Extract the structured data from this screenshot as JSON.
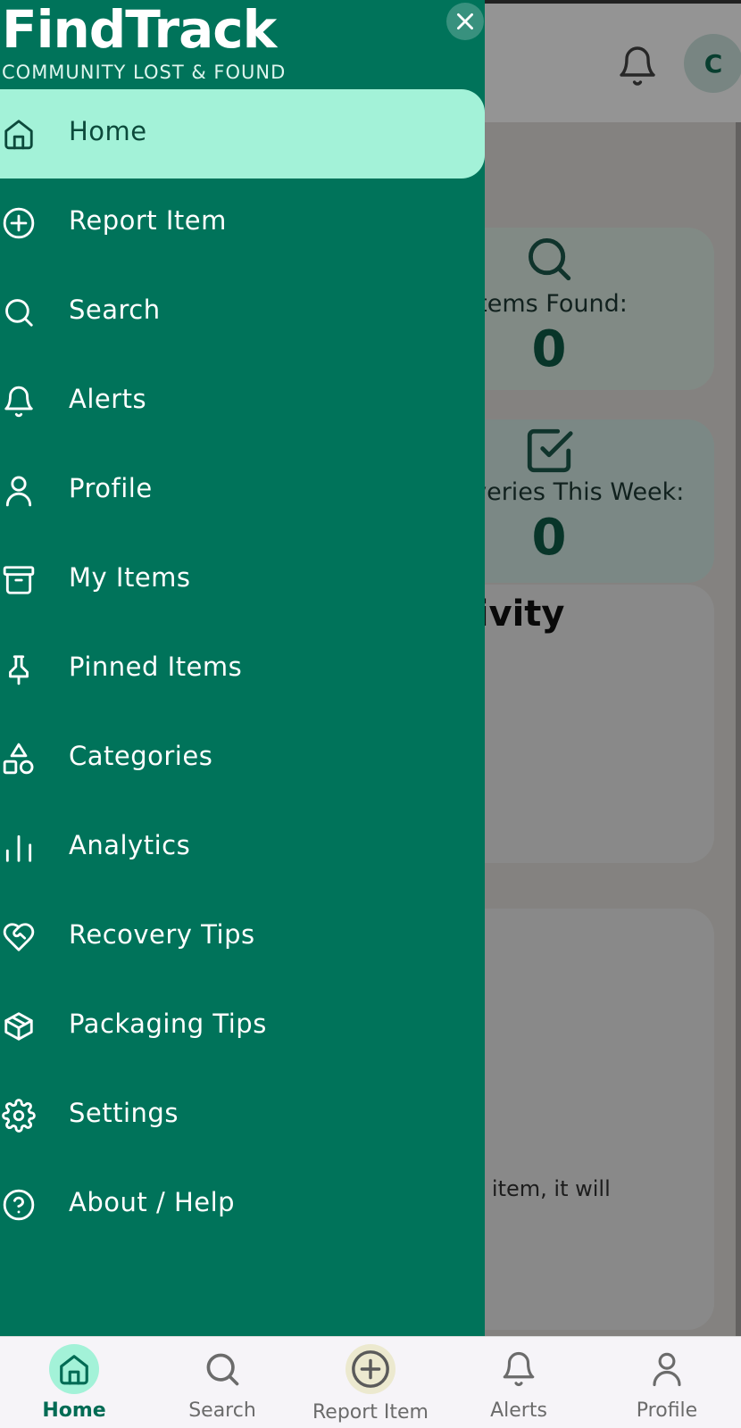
{
  "brand": {
    "title": "FindTrack",
    "subtitle": "COMMUNITY LOST & FOUND"
  },
  "header": {
    "avatar_initial": "C"
  },
  "dashboard": {
    "stat_items_found": {
      "label": "Items Found:",
      "value": "0"
    },
    "stat_recoveries": {
      "label": "Recoveries This Week:",
      "value": "0"
    },
    "activity_title": "Activity",
    "info_text": "reported item, it will"
  },
  "drawer": {
    "items": [
      {
        "label": "Home",
        "icon": "home-icon"
      },
      {
        "label": "Report Item",
        "icon": "plus-circle-icon"
      },
      {
        "label": "Search",
        "icon": "search-icon"
      },
      {
        "label": "Alerts",
        "icon": "bell-icon"
      },
      {
        "label": "Profile",
        "icon": "user-icon"
      },
      {
        "label": "My Items",
        "icon": "archive-icon"
      },
      {
        "label": "Pinned Items",
        "icon": "pin-icon"
      },
      {
        "label": "Categories",
        "icon": "shapes-icon"
      },
      {
        "label": "Analytics",
        "icon": "bar-chart-icon"
      },
      {
        "label": "Recovery Tips",
        "icon": "heart-handshake-icon"
      },
      {
        "label": "Packaging Tips",
        "icon": "package-icon"
      },
      {
        "label": "Settings",
        "icon": "gear-icon"
      },
      {
        "label": "About / Help",
        "icon": "help-circle-icon"
      }
    ],
    "active_index": 0
  },
  "bottom_nav": {
    "items": [
      {
        "label": "Home",
        "icon": "home-icon"
      },
      {
        "label": "Search",
        "icon": "search-icon"
      },
      {
        "label": "Report Item",
        "icon": "plus-circle-icon"
      },
      {
        "label": "Alerts",
        "icon": "bell-icon"
      },
      {
        "label": "Profile",
        "icon": "user-icon"
      }
    ],
    "active_index": 0
  },
  "colors": {
    "drawer_bg": "#00735a",
    "active_bg": "#a3f2d8",
    "accent": "#006b54"
  }
}
